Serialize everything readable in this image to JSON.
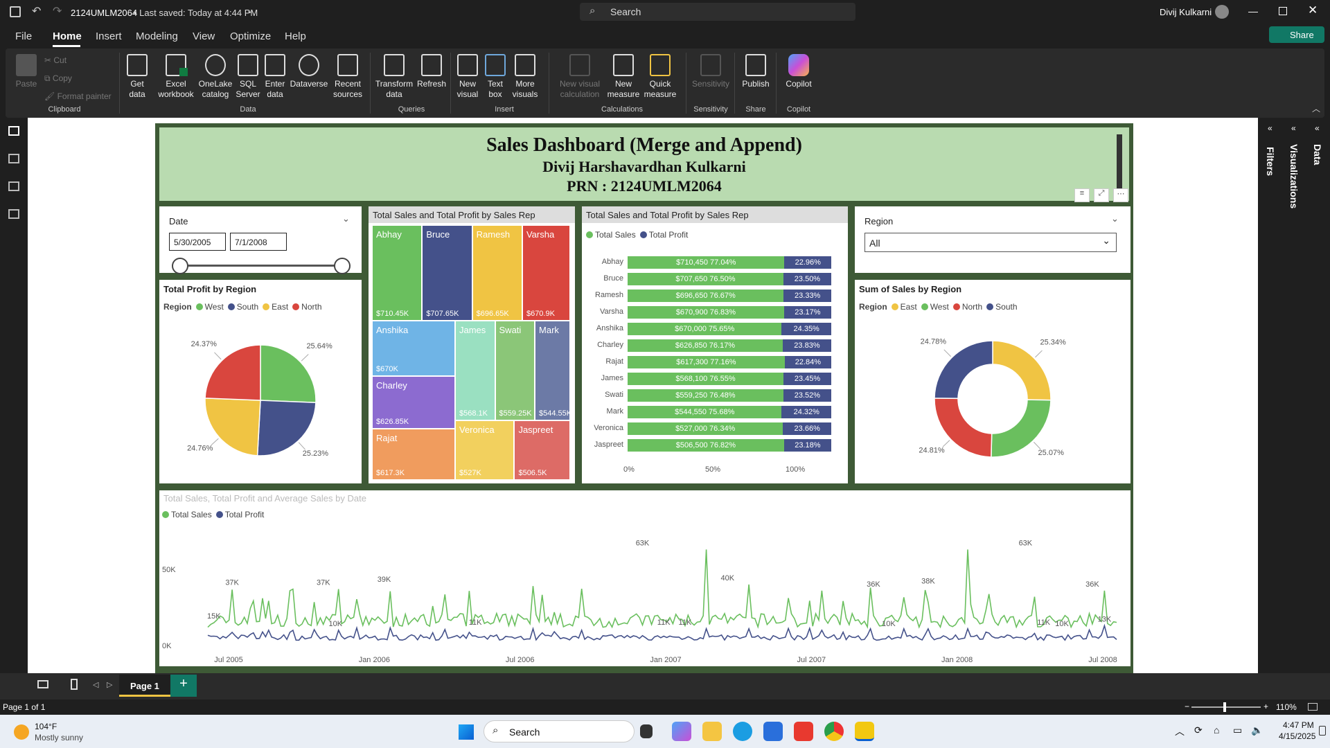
{
  "titlebar": {
    "file_name": "2124UMLM2064",
    "saved": "• Last saved: Today at 4:44 PM",
    "search": "Search",
    "user": "Divij Kulkarni"
  },
  "menu": [
    "File",
    "Home",
    "Insert",
    "Modeling",
    "View",
    "Optimize",
    "Help"
  ],
  "share": "Share",
  "ribbon": {
    "clipboard": {
      "paste": "Paste",
      "cut": "Cut",
      "copy": "Copy",
      "format_painter": "Format painter",
      "group": "Clipboard"
    },
    "data": {
      "get_data": "Get data",
      "excel": "Excel workbook",
      "onelake": "OneLake catalog",
      "sql": "SQL Server",
      "enter": "Enter data",
      "dataverse": "Dataverse",
      "recent": "Recent sources",
      "group": "Data"
    },
    "queries": {
      "transform": "Transform data",
      "refresh": "Refresh",
      "group": "Queries"
    },
    "insert": {
      "new_visual": "New visual",
      "text_box": "Text box",
      "more": "More visuals",
      "group": "Insert"
    },
    "calculations": {
      "new_calc": "New visual calculation",
      "new_measure": "New measure",
      "quick": "Quick measure",
      "group": "Calculations"
    },
    "sensitivity": {
      "label": "Sensitivity",
      "group": "Sensitivity"
    },
    "share": {
      "publish": "Publish",
      "group": "Share"
    },
    "copilot": {
      "label": "Copilot",
      "group": "Copilot"
    }
  },
  "side_panes": {
    "filters": "Filters",
    "visualizations": "Visualizations",
    "data": "Data"
  },
  "header": {
    "title": "Sales Dashboard (Merge and Append)",
    "name": "Divij Harshavardhan Kulkarni",
    "prn": "PRN : 2124UMLM2064"
  },
  "date_slicer": {
    "label": "Date",
    "start": "5/30/2005",
    "end": "7/1/2008"
  },
  "region_slicer": {
    "label": "Region",
    "value": "All"
  },
  "pie": {
    "title": "Total Profit by Region",
    "legend_title": "Region",
    "chart_data": {
      "type": "pie",
      "title": "Total Profit by Region",
      "categories": [
        "West",
        "South",
        "East",
        "North"
      ],
      "values": [
        25.64,
        25.23,
        24.76,
        24.37
      ],
      "colors": [
        "#6abf5e",
        "#44518a",
        "#f0c443",
        "#d9463e"
      ]
    },
    "labels": [
      "25.64%",
      "25.23%",
      "24.76%",
      "24.37%"
    ]
  },
  "treemap": {
    "title": "Total Sales and Total Profit by Sales Rep",
    "chart_data": {
      "type": "treemap",
      "categories": [
        "Abhay",
        "Bruce",
        "Ramesh",
        "Varsha",
        "Anshika",
        "Charley",
        "Rajat",
        "James",
        "Swati",
        "Mark",
        "Veronica",
        "Jaspreet"
      ],
      "values": [
        710450,
        707650,
        696650,
        670900,
        670000,
        626850,
        617300,
        568100,
        559250,
        544550,
        527000,
        506500
      ]
    },
    "tiles": [
      {
        "name": "Abhay",
        "value": "$710.45K",
        "color": "#6abf5e"
      },
      {
        "name": "Bruce",
        "value": "$707.65K",
        "color": "#44518a"
      },
      {
        "name": "Ramesh",
        "value": "$696.65K",
        "color": "#f0c443"
      },
      {
        "name": "Varsha",
        "value": "$670.9K",
        "color": "#d9463e"
      },
      {
        "name": "Anshika",
        "value": "$670K",
        "color": "#6fb4e6"
      },
      {
        "name": "Charley",
        "value": "$626.85K",
        "color": "#8c6bd0"
      },
      {
        "name": "Rajat",
        "value": "$617.3K",
        "color": "#f09c5e"
      },
      {
        "name": "James",
        "value": "$568.1K",
        "color": "#9ae0c1"
      },
      {
        "name": "Swati",
        "value": "$559.25K",
        "color": "#8bc678"
      },
      {
        "name": "Mark",
        "value": "$544.55K",
        "color": "#6c7aa6"
      },
      {
        "name": "Veronica",
        "value": "$527K",
        "color": "#f2d05e"
      },
      {
        "name": "Jaspreet",
        "value": "$506.5K",
        "color": "#dd6b66"
      }
    ]
  },
  "stacked": {
    "title": "Total Sales and Total Profit by Sales Rep",
    "legend": [
      "Total Sales",
      "Total Profit"
    ],
    "axis": [
      "0%",
      "50%",
      "100%"
    ],
    "chart_data": {
      "type": "bar",
      "stacked": "100%",
      "xlim": [
        0,
        100
      ],
      "categories": [
        "Abhay",
        "Bruce",
        "Ramesh",
        "Varsha",
        "Anshika",
        "Charley",
        "Rajat",
        "James",
        "Swati",
        "Mark",
        "Veronica",
        "Jaspreet"
      ],
      "series": [
        {
          "name": "Total Sales",
          "values": [
            77.04,
            76.5,
            76.67,
            76.83,
            75.65,
            76.17,
            77.16,
            76.55,
            76.48,
            75.68,
            76.34,
            76.82
          ]
        },
        {
          "name": "Total Profit",
          "values": [
            22.96,
            23.5,
            23.33,
            23.17,
            24.35,
            23.83,
            22.84,
            23.45,
            23.52,
            24.32,
            23.66,
            23.18
          ]
        }
      ]
    },
    "rows": [
      {
        "name": "Abhay",
        "sales": "$710,450 77.04%",
        "profit": "22.96%"
      },
      {
        "name": "Bruce",
        "sales": "$707,650 76.50%",
        "profit": "23.50%"
      },
      {
        "name": "Ramesh",
        "sales": "$696,650 76.67%",
        "profit": "23.33%"
      },
      {
        "name": "Varsha",
        "sales": "$670,900 76.83%",
        "profit": "23.17%"
      },
      {
        "name": "Anshika",
        "sales": "$670,000 75.65%",
        "profit": "24.35%"
      },
      {
        "name": "Charley",
        "sales": "$626,850 76.17%",
        "profit": "23.83%"
      },
      {
        "name": "Rajat",
        "sales": "$617,300 77.16%",
        "profit": "22.84%"
      },
      {
        "name": "James",
        "sales": "$568,100 76.55%",
        "profit": "23.45%"
      },
      {
        "name": "Swati",
        "sales": "$559,250 76.48%",
        "profit": "23.52%"
      },
      {
        "name": "Mark",
        "sales": "$544,550 75.68%",
        "profit": "24.32%"
      },
      {
        "name": "Veronica",
        "sales": "$527,000 76.34%",
        "profit": "23.66%"
      },
      {
        "name": "Jaspreet",
        "sales": "$506,500 76.82%",
        "profit": "23.18%"
      }
    ]
  },
  "donut": {
    "title": "Sum of Sales by Region",
    "legend_title": "Region",
    "chart_data": {
      "type": "pie",
      "donut": true,
      "title": "Sum of Sales by Region",
      "categories": [
        "East",
        "West",
        "North",
        "South"
      ],
      "values": [
        25.34,
        25.07,
        24.81,
        24.78
      ],
      "colors": [
        "#f0c443",
        "#6abf5e",
        "#d9463e",
        "#44518a"
      ]
    },
    "labels": [
      "25.34%",
      "25.07%",
      "24.81%",
      "24.78%"
    ]
  },
  "line": {
    "title": "Total Sales, Total Profit and Average Sales by Date",
    "legend": [
      "Total Sales",
      "Total Profit"
    ],
    "yticks": [
      "50K",
      "0K"
    ],
    "xticks": [
      "Jul 2005",
      "Jan 2006",
      "Jul 2006",
      "Jan 2007",
      "Jul 2007",
      "Jan 2008",
      "Jul 2008"
    ],
    "chart_data": {
      "type": "line",
      "ylim": [
        0,
        70000
      ],
      "x": [
        "2005-06",
        "2005-07",
        "2005-09",
        "2006-07",
        "2007-02",
        "2007-04",
        "2007-06",
        "2007-08",
        "2007-12",
        "2008-06"
      ],
      "series": [
        {
          "name": "Total Sales",
          "values": [
            15000,
            37000,
            37000,
            39000,
            63000,
            40000,
            36000,
            38000,
            63000,
            36000
          ]
        },
        {
          "name": "Total Profit",
          "values": [
            5000,
            10000,
            10000,
            11000,
            11000,
            11000,
            10000,
            11000,
            11000,
            13000
          ]
        }
      ]
    },
    "labels": [
      "15K",
      "37K",
      "37K",
      "10K",
      "39K",
      "11K",
      "63K",
      "11K",
      "11K",
      "40K",
      "36K",
      "10K",
      "38K",
      "63K",
      "11K",
      "10K",
      "36K",
      "13K"
    ]
  },
  "page_tabs": {
    "page": "Page 1",
    "add": "+"
  },
  "status": {
    "page": "Page 1 of 1",
    "zoom": "110%"
  },
  "taskbar": {
    "temp": "104°F",
    "weather": "Mostly sunny",
    "search": "Search",
    "time": "4:47 PM",
    "date": "4/15/2025"
  }
}
